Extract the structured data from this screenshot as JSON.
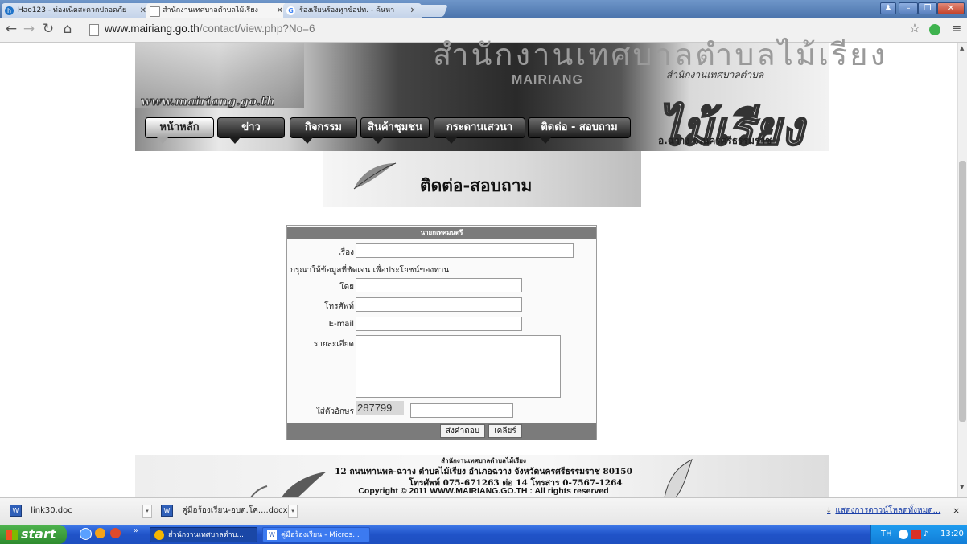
{
  "browser": {
    "tabs": [
      {
        "title": "Hao123 - ท่องเน็ตสะดวกปลอดภัย",
        "icon": "hao123-icon",
        "active": false
      },
      {
        "title": "สำนักงานเทศบาลตำบลไม้เรียง",
        "icon": "page-icon",
        "active": true
      },
      {
        "title": "ร้องเรียนร้องทุกข์อปท. - ค้นหา",
        "icon": "google-icon",
        "active": false
      }
    ],
    "url_host": "www.mairiang.go.th",
    "url_path": "/contact/view.php?No=6"
  },
  "banner": {
    "title_th": "สำนักงานเทศบาลตำบลไม้เรียง",
    "title_en": "MAIRIANG",
    "subtitle": "สำนักงานเทศบาลตำบล",
    "big_name": "ไม้เรียง",
    "location": "อ.ฉวาง จ.นครศรีธรรมราช",
    "website": "www.mairiang.go.th"
  },
  "nav": [
    {
      "label": "หน้าหลัก"
    },
    {
      "label": "ข่าว"
    },
    {
      "label": "กิจกรรม"
    },
    {
      "label": "สินค้าชุมชน"
    },
    {
      "label": "กระดานเสวนา"
    },
    {
      "label": "ติดต่อ - สอบถาม"
    }
  ],
  "heading": "ติดต่อ-สอบถาม",
  "form": {
    "header": "นายกเทศมนตรี",
    "subject_label": "เรื่อง",
    "note": "กรุณาให้ข้อมูลที่ชัดเจน เพื่อประโยชน์ของท่าน",
    "by_label": "โดย",
    "phone_label": "โทรศัพท์",
    "email_label": "E-mail",
    "detail_label": "รายละเอียด",
    "captcha_label": "ใส่ตัวอักษร",
    "captcha_code": "287799",
    "submit_label": "ส่งคำตอบ",
    "clear_label": "เคลียร์"
  },
  "footer": {
    "line1": "สำนักงานเทศบาลตำบลไม้เรียง",
    "line2": "12 ถนนทานพล-ฉวาง ตำบลไม้เรียง อำเภอฉวาง จังหวัดนครศรีธรรมราช 80150",
    "line3": "โทรศัพท์ 075-671263 ต่อ 14 โทรสาร 0-7567-1264",
    "line4": "Copyright © 2011 WWW.MAIRIANG.GO.TH : All rights reserved"
  },
  "downloads": {
    "items": [
      {
        "name": "link30.doc"
      },
      {
        "name": "คู่มือร้องเรียน-อบต.โค....docx"
      }
    ],
    "show_all": "แสดงการดาวน์โหลดทั้งหมด...",
    "close": "×"
  },
  "taskbar": {
    "start": "start",
    "buttons": [
      {
        "label": "สำนักงานเทศบาลตำบ..."
      },
      {
        "label": "คู่มือร้องเรียน - Micros..."
      }
    ],
    "lang": "TH",
    "clock": "13:20"
  },
  "colors": {
    "tab_strip": "#5a82ba",
    "nav_button": "#1c1c1c",
    "form_header": "#7b7b7b",
    "taskbar": "#245edb",
    "start_button": "#3a9b3a"
  }
}
